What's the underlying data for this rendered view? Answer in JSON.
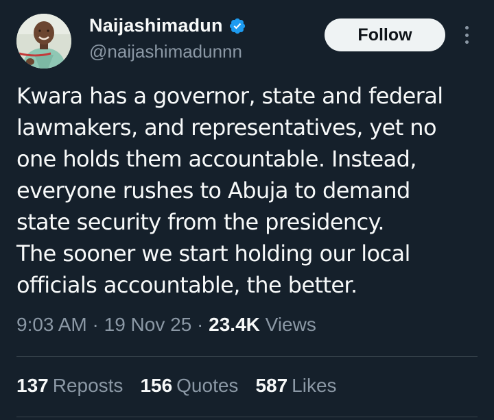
{
  "author": {
    "display_name": "Naijashimadun",
    "handle": "@naijashimadunnn",
    "verified": true,
    "verified_color": "#1d9bf0"
  },
  "actions": {
    "follow_label": "Follow",
    "more_icon": "more-vertical-icon"
  },
  "tweet": {
    "text_lines": [
      "Kwara has a governor, state and federal",
      "lawmakers, and representatives, yet no",
      "one holds them accountable. Instead,",
      "everyone rushes to Abuja to demand",
      "state security from the presidency.",
      "The sooner we start holding our local",
      "officials accountable, the better."
    ],
    "time": "9:03 AM",
    "date": "19 Nov 25",
    "views_count": "23.4K",
    "views_label": "Views"
  },
  "stats": {
    "reposts_count": "137",
    "reposts_label": "Reposts",
    "quotes_count": "156",
    "quotes_label": "Quotes",
    "likes_count": "587",
    "likes_label": "Likes"
  },
  "colors": {
    "background": "#15202b",
    "primary_text": "#f7f9f9",
    "secondary_text": "#8b98a5",
    "follow_bg": "#eff3f4",
    "divider": "#38444d"
  }
}
